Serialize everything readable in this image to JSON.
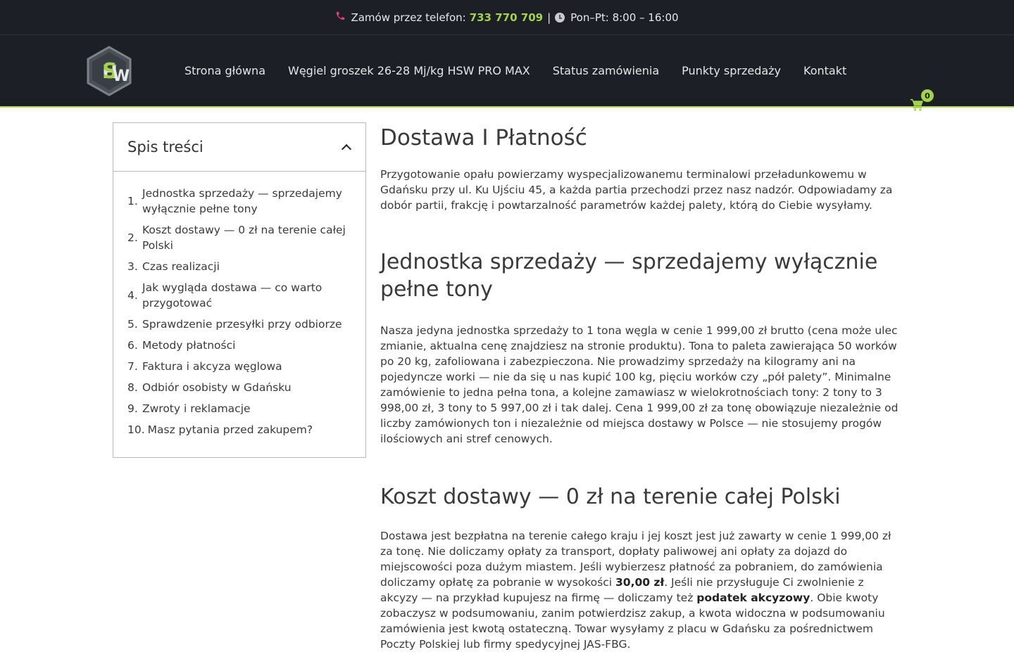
{
  "topbar": {
    "phone_icon": "phone-icon",
    "order_label": "Zamów przez telefon:",
    "phone_number": "733 770 709",
    "separator": "|",
    "clock_icon": "clock-icon",
    "hours": "Pon–Pt: 8:00 – 16:00",
    "accent_color": "#a3d34a",
    "phone_icon_color": "#e2407a"
  },
  "header": {
    "logo_text": "HSW",
    "nav": [
      {
        "label": "Strona główna"
      },
      {
        "label": "Węgiel groszek 26-28 Mj/kg HSW PRO MAX"
      },
      {
        "label": "Status zamówienia"
      },
      {
        "label": "Punkty sprzedaży"
      },
      {
        "label": "Kontakt"
      }
    ],
    "cart_icon": "cart-icon",
    "cart_count": "0",
    "background_color": "#1c1f26"
  },
  "toc": {
    "title": "Spis treści",
    "toggle_icon": "chevron-up-icon",
    "items": [
      {
        "num": "1.",
        "label": "Jednostka sprzedaży — sprzedajemy wyłącznie pełne tony"
      },
      {
        "num": "2.",
        "label": "Koszt dostawy — 0 zł na terenie całej Polski"
      },
      {
        "num": "3.",
        "label": "Czas realizacji"
      },
      {
        "num": "4.",
        "label": "Jak wygląda dostawa — co warto przygotować"
      },
      {
        "num": "5.",
        "label": "Sprawdzenie przesyłki przy odbiorze"
      },
      {
        "num": "6.",
        "label": "Metody płatności"
      },
      {
        "num": "7.",
        "label": "Faktura i akcyza węglowa"
      },
      {
        "num": "8.",
        "label": "Odbiór osobisty w Gdańsku"
      },
      {
        "num": "9.",
        "label": "Zwroty i reklamacje"
      },
      {
        "num": "10.",
        "label": "Masz pytania przed zakupem?"
      }
    ]
  },
  "main": {
    "title": "Dostawa I Płatność",
    "intro": "Przygotowanie opału powierzamy wyspecjalizowanemu terminalowi przeładunkowemu w Gdańsku przy ul. Ku Ujściu 45, a każda partia przechodzi przez nasz nadzór. Odpowiadamy za dobór partii, frakcję i powtarzalność parametrów każdej palety, którą do Ciebie wysyłamy.",
    "section1": {
      "heading": "Jednostka sprzedaży — sprzedajemy wyłącznie pełne tony",
      "body": "Nasza jedyna jednostka sprzedaży to 1 tona węgla w cenie 1 999,00 zł brutto (cena może ulec zmianie, aktualna cenę znajdziesz na stronie produktu). Tona to paleta zawierająca 50 worków po 20 kg, zafoliowana i zabezpieczona. Nie prowadzimy sprzedaży na kilogramy ani na pojedyncze worki — nie da się u nas kupić 100 kg, pięciu worków czy „pół palety”. Minimalne zamówienie to jedna pełna tona, a kolejne zamawiasz w wielokrotnościach tony: 2 tony to 3 998,00 zł, 3 tony to 5 997,00 zł i tak dalej. Cena 1 999,00 zł za tonę obowiązuje niezależnie od liczby zamówionych ton i niezależnie od miejsca dostawy w Polsce — nie stosujemy progów ilościowych ani stref cenowych."
    },
    "section2": {
      "heading": "Koszt dostawy — 0 zł na terenie całej Polski",
      "body_part1": "Dostawa jest bezpłatna na terenie całego kraju i jej koszt jest już zawarty w cenie 1 999,00 zł za tonę. Nie doliczamy opłaty za transport, dopłaty paliwowej ani opłaty za dojazd do miejscowości poza dużym miastem. Jeśli wybierzesz płatność za pobraniem, do zamówienia doliczamy opłatę za pobranie w wysokości ",
      "fee": "30,00 zł",
      "body_part2": ". Jeśli nie przysługuje Ci zwolnienie z akcyzy — na przykład kupujesz na firmę — doliczamy też ",
      "tax": "podatek akcyzowy",
      "body_part3": ". Obie kwoty zobaczysz w podsumowaniu, zanim potwierdzisz zakup, a kwota widoczna w podsumowaniu zamówienia jest kwotą ostateczną. Towar wysyłamy z placu w Gdańsku za pośrednictwem Poczty Polskiej lub firmy spedycyjnej JAS-FBG."
    }
  }
}
